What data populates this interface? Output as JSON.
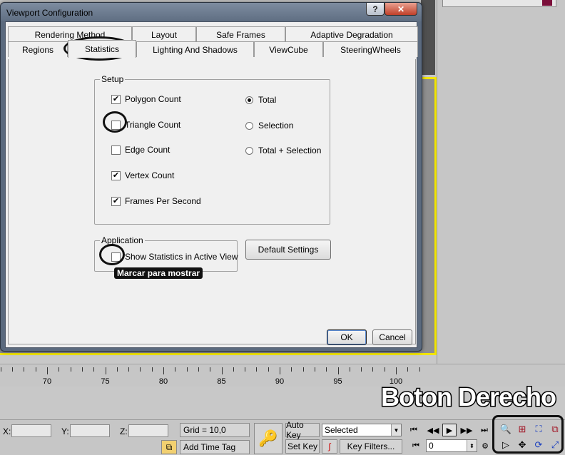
{
  "dialog": {
    "title": "Viewport Configuration",
    "help_label": "?",
    "close_label": "✕",
    "tabs_row1": [
      "Rendering Method",
      "Layout",
      "Safe Frames",
      "Adaptive Degradation"
    ],
    "tabs_row2": [
      "Regions",
      "Statistics",
      "Lighting And Shadows",
      "ViewCube",
      "SteeringWheels"
    ],
    "active_tab": "Statistics",
    "setup": {
      "label": "Setup",
      "checkboxes": [
        {
          "label": "Polygon Count",
          "checked": true
        },
        {
          "label": "Triangle Count",
          "checked": false
        },
        {
          "label": "Edge Count",
          "checked": false
        },
        {
          "label": "Vertex Count",
          "checked": true
        },
        {
          "label": "Frames Per Second",
          "checked": true
        }
      ],
      "radios": [
        {
          "label": "Total",
          "selected": true
        },
        {
          "label": "Selection",
          "selected": false
        },
        {
          "label": "Total + Selection",
          "selected": false
        }
      ]
    },
    "application": {
      "label": "Application",
      "checkbox_label": "Show Statistics in Active View",
      "checked": false
    },
    "default_settings_label": "Default Settings",
    "ok_label": "OK",
    "cancel_label": "Cancel"
  },
  "annotations": {
    "marcar": "Marcar para mostrar",
    "boton": "Boton Derecho"
  },
  "timeline": {
    "labels": [
      "70",
      "75",
      "80",
      "85",
      "90",
      "95",
      "100"
    ]
  },
  "bottom": {
    "x_label": "X:",
    "y_label": "Y:",
    "z_label": "Z:",
    "grid": "Grid = 10,0",
    "add_time_tag": "Add Time Tag",
    "auto_key": "Auto Key",
    "set_key": "Set Key",
    "selected": "Selected",
    "key_filters": "Key Filters...",
    "frame": "0"
  },
  "colors": {
    "viewport_border": "#f2e500",
    "annotation": "#111111"
  }
}
